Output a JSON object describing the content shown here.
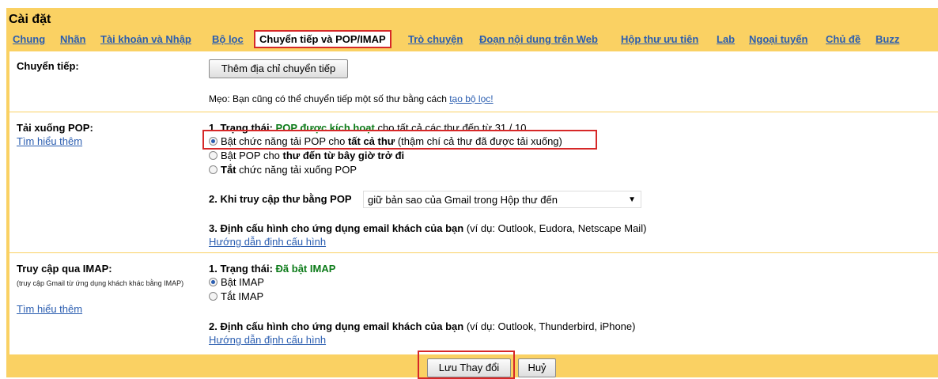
{
  "title": "Cài đặt",
  "tabs": [
    "Chung",
    "Nhãn",
    "Tài khoản và Nhập",
    "Bộ lọc",
    "Chuyển tiếp và POP/IMAP",
    "Trò chuyện",
    "Đoạn nội dung trên Web",
    "Hộp thư ưu tiên",
    "Lab",
    "Ngoại tuyến",
    "Chủ đề",
    "Buzz"
  ],
  "forwarding": {
    "label": "Chuyển tiếp:",
    "add_button": "Thêm địa chỉ chuyển tiếp",
    "tip_prefix": "Mẹo: Bạn cũng có thể chuyển tiếp một số thư bằng cách ",
    "tip_link": "tạo bộ lọc!"
  },
  "pop": {
    "label": "Tải xuống POP:",
    "learn_more": "Tìm hiểu thêm",
    "status_label": "1. Trạng thái:",
    "status_value": "POP được kích hoạt",
    "status_suffix": "cho tất cả các thư đến từ 31 / 10",
    "options": [
      {
        "pre": "Bật chức năng tải POP cho ",
        "bold": "tất cả thư",
        "post": " (thậm chí cả thư đã được tải xuống)",
        "checked": true
      },
      {
        "pre": "Bật POP cho ",
        "bold": "thư đến từ bây giờ trở đi",
        "post": "",
        "checked": false
      },
      {
        "pre": "",
        "bold": "Tắt",
        "post": " chức năng tải xuống POP",
        "checked": false
      }
    ],
    "access_label": "2. Khi truy cập thư bằng POP",
    "access_value": "giữ bản sao của Gmail trong Hộp thư đến",
    "config_label": "3. Định cấu hình cho ứng dụng email khách của bạn",
    "config_note": "(ví dụ: Outlook, Eudora, Netscape Mail)",
    "config_link": "Hướng dẫn định cấu hình"
  },
  "imap": {
    "label": "Truy cập qua IMAP:",
    "sub": "(truy cập Gmail từ ứng dụng khách khác bằng IMAP)",
    "learn_more": "Tìm hiểu thêm",
    "status_label": "1. Trạng thái:",
    "status_value": "Đã bật IMAP",
    "options": [
      {
        "text": "Bật IMAP",
        "checked": true
      },
      {
        "text": "Tắt IMAP",
        "checked": false
      }
    ],
    "config_label": "2. Định cấu hình cho ứng dụng email khách của bạn",
    "config_note": "(ví dụ: Outlook, Thunderbird, iPhone)",
    "config_link": "Hướng dẫn định cấu hình"
  },
  "footer": {
    "save": "Lưu Thay đổi",
    "cancel": "Huỷ"
  },
  "colors": {
    "accent_frame": "#fad163",
    "link": "#2a5db0",
    "status_green": "#0c7b19",
    "highlight_red": "#d62828"
  }
}
